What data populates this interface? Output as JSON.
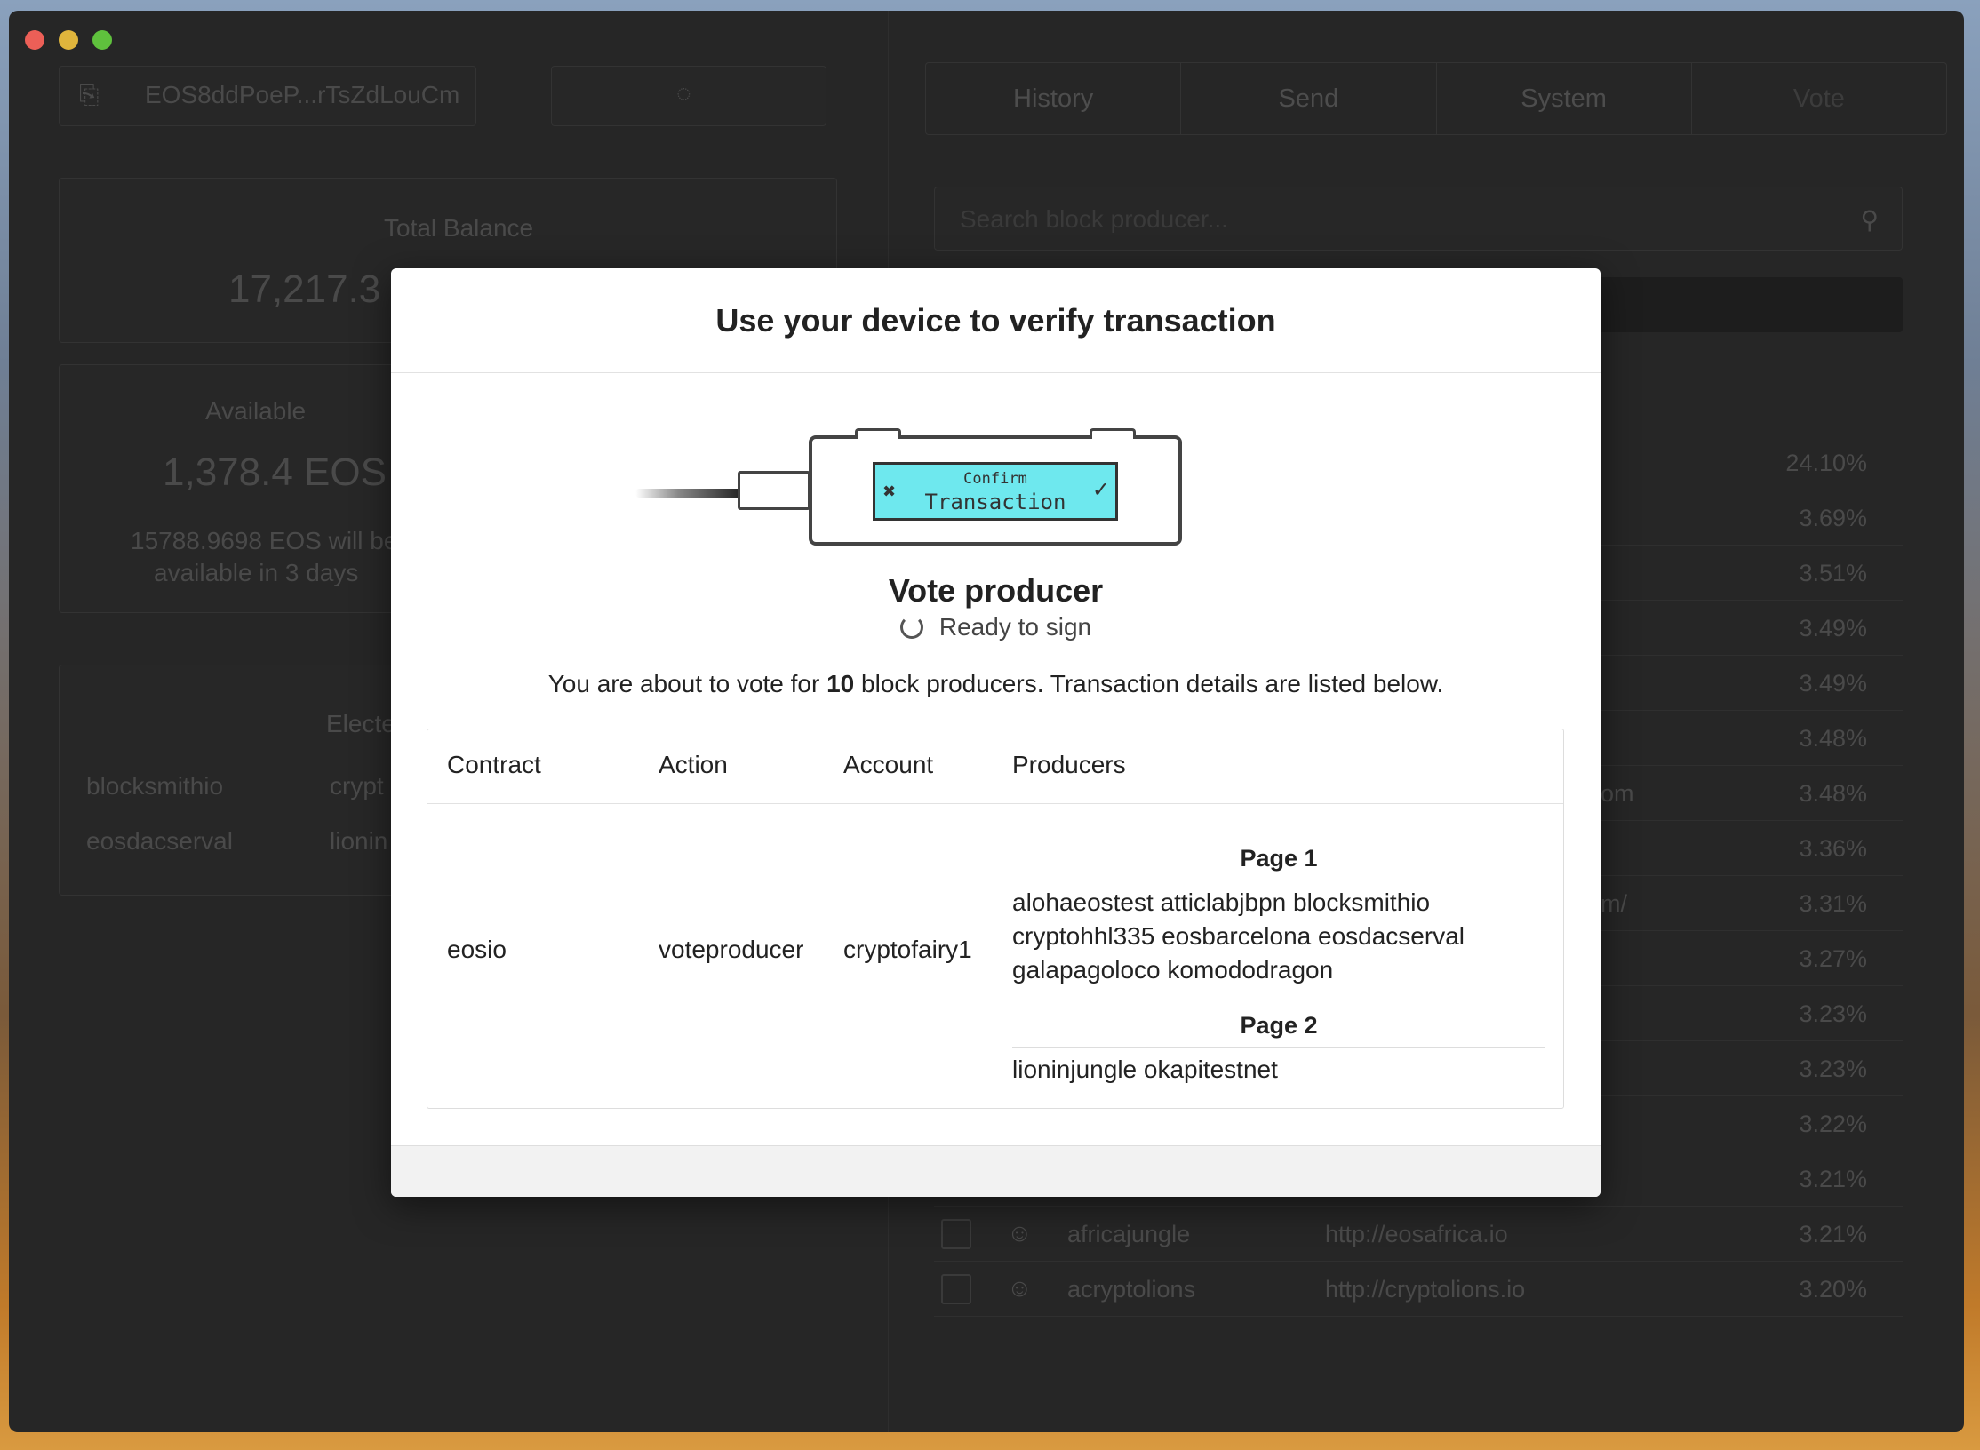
{
  "wallet": {
    "address": "EOS8ddPoeP...rTsZdLouCm",
    "total_balance_label": "Total Balance",
    "total_balance_value": "17,217.3",
    "available_label": "Available",
    "available_value": "1,378.4 EOS",
    "unlock_note_line1": "15788.9698 EOS will be",
    "unlock_note_line2": "available in 3 days",
    "elected_label": "Electe",
    "elected": [
      {
        "a": "blocksmithio",
        "b": "crypt"
      },
      {
        "a": "eosdacserval",
        "b": "lionin"
      }
    ]
  },
  "tabs": [
    "History",
    "Send",
    "System",
    "Vote"
  ],
  "search": {
    "placeholder": "Search block producer..."
  },
  "producer_rows": [
    {
      "pct": "24.10%",
      "name": "",
      "url": ""
    },
    {
      "pct": "3.69%",
      "name": "",
      "url": ""
    },
    {
      "pct": "3.51%",
      "name": "",
      "url": ""
    },
    {
      "pct": "3.49%",
      "name": "",
      "url": ""
    },
    {
      "pct": "3.49%",
      "name": "",
      "url": ""
    },
    {
      "pct": "3.48%",
      "name": "",
      "url": ""
    },
    {
      "pct": "3.48%",
      "name": "",
      "url": "om"
    },
    {
      "pct": "3.36%",
      "name": "",
      "url": ""
    },
    {
      "pct": "3.31%",
      "name": "",
      "url": "m/"
    },
    {
      "pct": "3.27%",
      "name": "",
      "url": ""
    },
    {
      "pct": "3.23%",
      "name": "",
      "url": ""
    },
    {
      "pct": "3.23%",
      "name": "",
      "url": ""
    },
    {
      "pct": "3.22%",
      "name": "",
      "url": ""
    },
    {
      "pct": "3.21%",
      "name": "",
      "url": ""
    },
    {
      "pct": "3.21%",
      "name": "africajungle",
      "url": "http://eosafrica.io"
    },
    {
      "pct": "3.20%",
      "name": "acryptolions",
      "url": "http://cryptolions.io"
    }
  ],
  "modal": {
    "title": "Use your device to verify transaction",
    "device_screen_small": "Confirm",
    "device_screen_big": "Transaction",
    "action_title": "Vote producer",
    "status": "Ready to sign",
    "desc_prefix": "You are about to vote for ",
    "desc_count": "10",
    "desc_suffix": " block producers. Transaction details are listed below.",
    "table": {
      "headers": [
        "Contract",
        "Action",
        "Account",
        "Producers"
      ],
      "contract": "eosio",
      "action": "voteproducer",
      "account": "cryptofairy1",
      "pages": [
        {
          "label": "Page 1",
          "lines": [
            "alohaeostest atticlabjbpn blocksmithio",
            "cryptohhl335 eosbarcelona eosdacserval",
            "galapagoloco komododragon"
          ]
        },
        {
          "label": "Page 2",
          "lines": [
            "lioninjungle okapitestnet"
          ]
        }
      ]
    }
  }
}
